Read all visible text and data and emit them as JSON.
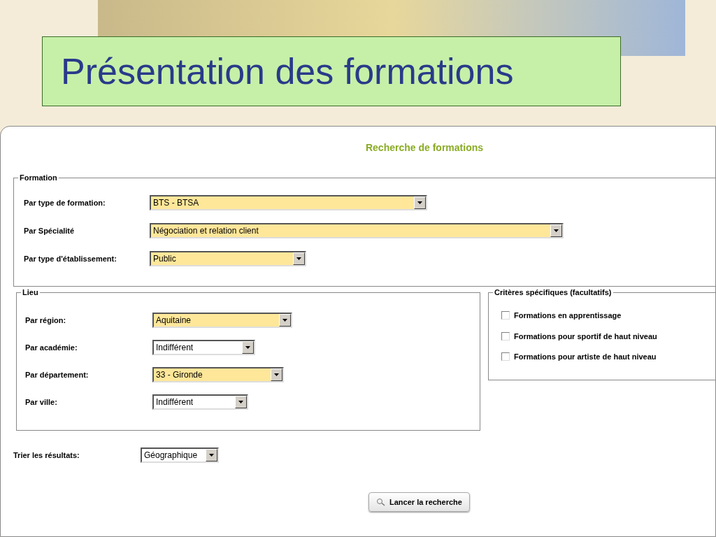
{
  "slide_title": "Présentation des formations",
  "form": {
    "heading": "Recherche de formations",
    "formation": {
      "legend": "Formation",
      "fields": [
        {
          "label": "Par type de formation:",
          "value": "BTS - BTSA",
          "highlighted": true
        },
        {
          "label": "Par Spécialité",
          "value": "Négociation et relation client",
          "highlighted": true
        },
        {
          "label": "Par type d'établissement:",
          "value": "Public",
          "highlighted": true
        }
      ]
    },
    "lieu": {
      "legend": "Lieu",
      "fields": [
        {
          "label": "Par région:",
          "value": "Aquitaine",
          "highlighted": true
        },
        {
          "label": "Par académie:",
          "value": "Indifférent",
          "highlighted": false
        },
        {
          "label": "Par département:",
          "value": "33 - Gironde",
          "highlighted": true
        },
        {
          "label": "Par ville:",
          "value": "Indifférent",
          "highlighted": false
        }
      ]
    },
    "criteria": {
      "legend": "Critères spécifiques (facultatifs)",
      "options": [
        {
          "label": "Formations en apprentissage",
          "checked": false
        },
        {
          "label": "Formations pour sportif de haut niveau",
          "checked": false
        },
        {
          "label": "Formations pour artiste de haut niveau",
          "checked": false
        }
      ]
    },
    "sort": {
      "label": "Trier les résultats:",
      "value": "Géographique",
      "highlighted": false
    },
    "submit": "Lancer la recherche"
  }
}
